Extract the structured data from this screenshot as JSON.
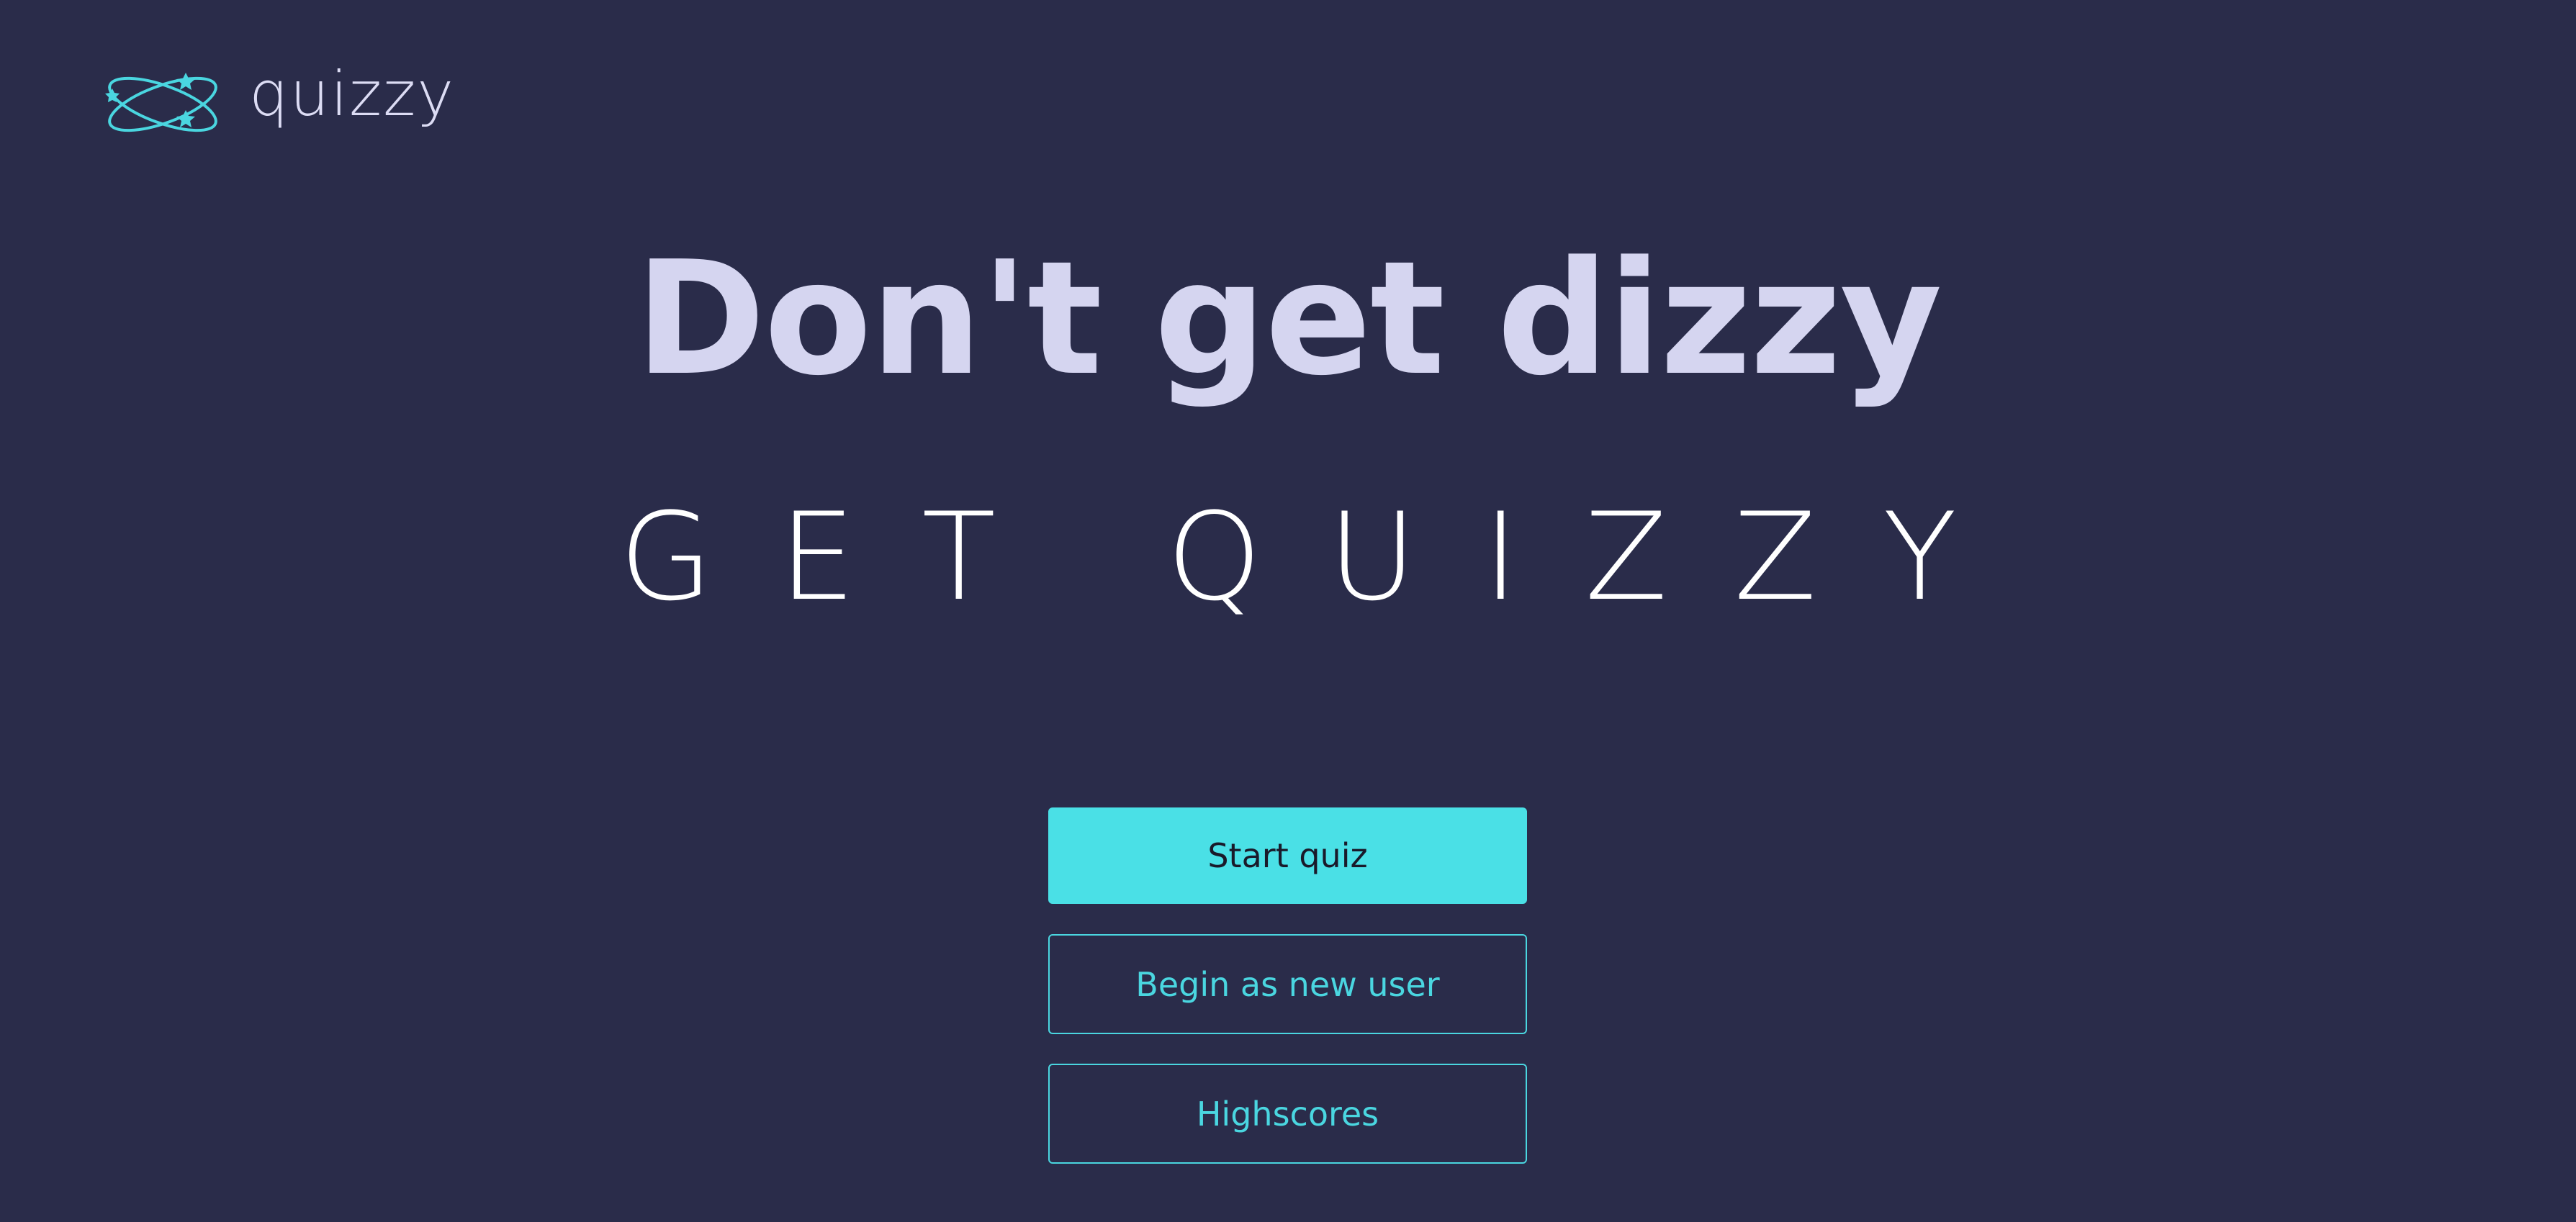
{
  "header": {
    "logo_icon": "orbit-stars-icon",
    "brand": "quizzy"
  },
  "hero": {
    "headline": "Don't get dizzy",
    "tagline": "GET QUIZZY"
  },
  "actions": {
    "start_quiz": "Start quiz",
    "new_user": "Begin as new user",
    "highscores": "Highscores"
  },
  "colors": {
    "background": "#2a2c4a",
    "accent": "#4ae0e6",
    "headline": "#d5d5f0",
    "tagline": "#ffffff"
  }
}
